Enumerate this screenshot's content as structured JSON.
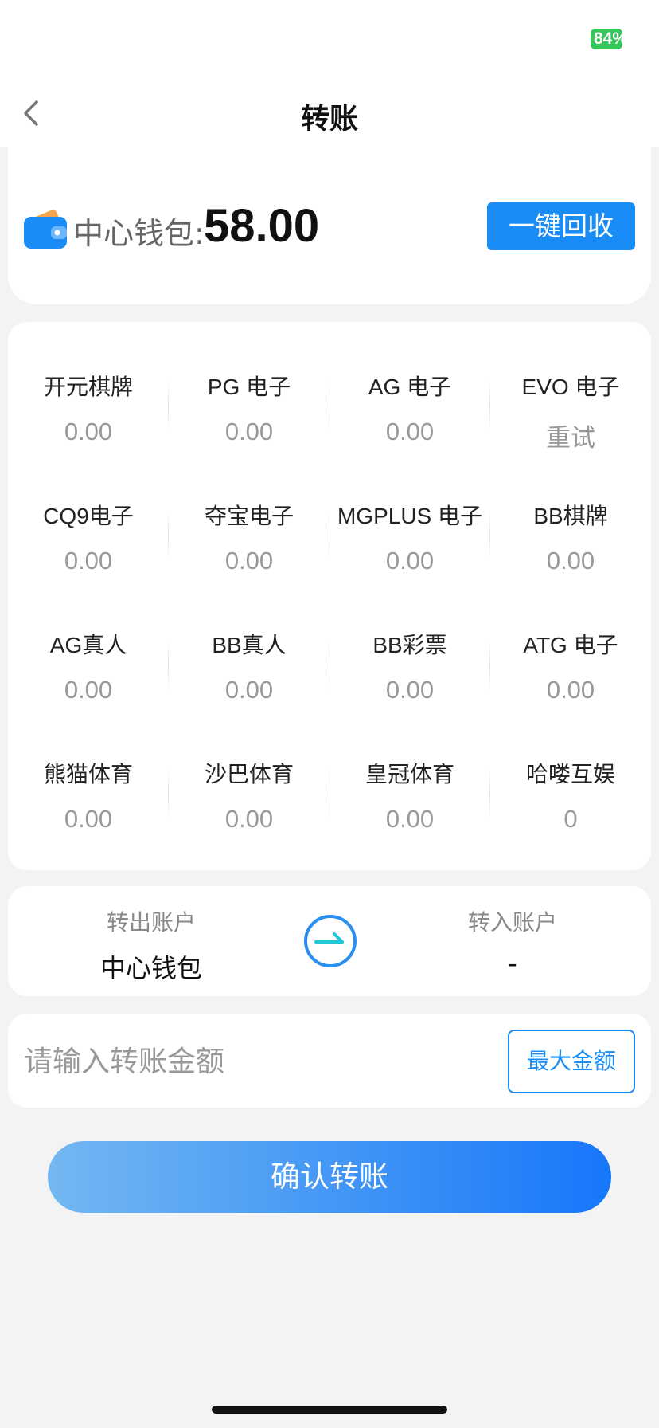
{
  "status_bar": {
    "battery": "84%"
  },
  "header": {
    "title": "转账"
  },
  "wallet": {
    "label": "中心钱包:",
    "amount": "58.00",
    "recycle_label": "一键回收"
  },
  "platforms": [
    {
      "name": "开元棋牌",
      "balance": "0.00"
    },
    {
      "name": "PG 电子",
      "balance": "0.00"
    },
    {
      "name": "AG 电子",
      "balance": "0.00"
    },
    {
      "name": "EVO 电子",
      "balance": "重试"
    },
    {
      "name": "CQ9电子",
      "balance": "0.00"
    },
    {
      "name": "夺宝电子",
      "balance": "0.00"
    },
    {
      "name": "MGPLUS 电子",
      "balance": "0.00"
    },
    {
      "name": "BB棋牌",
      "balance": "0.00"
    },
    {
      "name": "AG真人",
      "balance": "0.00"
    },
    {
      "name": "BB真人",
      "balance": "0.00"
    },
    {
      "name": "BB彩票",
      "balance": "0.00"
    },
    {
      "name": "ATG 电子",
      "balance": "0.00"
    },
    {
      "name": "熊猫体育",
      "balance": "0.00"
    },
    {
      "name": "沙巴体育",
      "balance": "0.00"
    },
    {
      "name": "皇冠体育",
      "balance": "0.00"
    },
    {
      "name": "哈喽互娱",
      "balance": "0"
    }
  ],
  "transfer": {
    "from_label": "转出账户",
    "from_value": "中心钱包",
    "to_label": "转入账户",
    "to_value": "-"
  },
  "amount_input": {
    "placeholder": "请输入转账金额",
    "max_label": "最大金额"
  },
  "confirm_label": "确认转账",
  "colors": {
    "accent": "#1a8cf5",
    "battery": "#34c759",
    "background": "#f3f3f3",
    "swap_ring": "#2a8ff0",
    "swap_arrow": "#22c7d6"
  }
}
